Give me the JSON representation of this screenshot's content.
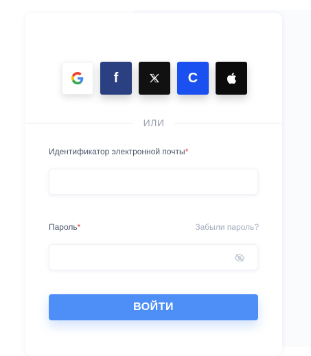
{
  "social": [
    {
      "name": "google",
      "icon": "google-icon"
    },
    {
      "name": "facebook",
      "icon": "facebook-icon",
      "glyph": "f"
    },
    {
      "name": "x",
      "icon": "x-icon"
    },
    {
      "name": "c",
      "icon": "c-icon",
      "glyph": "C"
    },
    {
      "name": "apple",
      "icon": "apple-icon"
    }
  ],
  "divider_text": "ИЛИ",
  "email": {
    "label": "Идентификатор электронной почты",
    "required_mark": "*",
    "value": ""
  },
  "password": {
    "label": "Пароль",
    "required_mark": "*",
    "value": "",
    "forgot_link": "Забыли пароль?",
    "toggle_icon": "eye-off-icon"
  },
  "submit_label": "ВОЙТИ",
  "colors": {
    "accent": "#4e8ff7",
    "facebook": "#2b4080",
    "brand_c": "#1a4ff0",
    "required": "#e53e3e"
  }
}
